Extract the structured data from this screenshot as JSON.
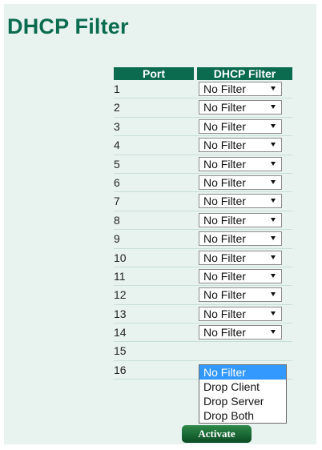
{
  "page": {
    "title": "DHCP Filter"
  },
  "table": {
    "headers": {
      "port": "Port",
      "filter": "DHCP Filter"
    },
    "rows": [
      {
        "port": "1",
        "value": "No Filter"
      },
      {
        "port": "2",
        "value": "No Filter"
      },
      {
        "port": "3",
        "value": "No Filter"
      },
      {
        "port": "4",
        "value": "No Filter"
      },
      {
        "port": "5",
        "value": "No Filter"
      },
      {
        "port": "6",
        "value": "No Filter"
      },
      {
        "port": "7",
        "value": "No Filter"
      },
      {
        "port": "8",
        "value": "No Filter"
      },
      {
        "port": "9",
        "value": "No Filter"
      },
      {
        "port": "10",
        "value": "No Filter"
      },
      {
        "port": "11",
        "value": "No Filter"
      },
      {
        "port": "12",
        "value": "No Filter"
      },
      {
        "port": "13",
        "value": "No Filter"
      },
      {
        "port": "14",
        "value": "No Filter"
      },
      {
        "port": "15",
        "value": ""
      },
      {
        "port": "16",
        "value": ""
      }
    ]
  },
  "dropdown": {
    "open_on_port": "14",
    "options": [
      "No Filter",
      "Drop Client",
      "Drop Server",
      "Drop Both"
    ],
    "highlighted": "No Filter"
  },
  "actions": {
    "activate_label": "Activate"
  }
}
